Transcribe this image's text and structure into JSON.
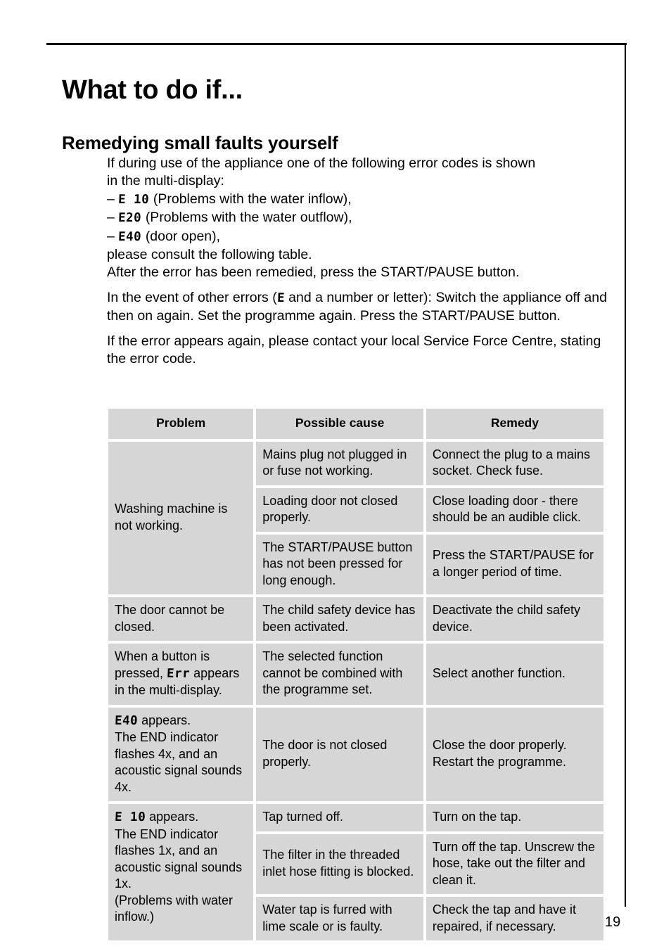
{
  "page": {
    "title": "What to do if...",
    "subtitle": "Remedying small faults yourself",
    "number": "19"
  },
  "intro": {
    "para1_line1": "If during use of the appliance one of the following error codes is shown",
    "para1_line2": "in the multi-display:",
    "bullet1_dash": "–",
    "bullet1_code": "E 10",
    "bullet1_text": "(Problems with the water inflow),",
    "bullet2_dash": "–",
    "bullet2_code": "E20",
    "bullet2_text": "(Problems with the water outflow),",
    "bullet3_dash": "–",
    "bullet3_code": "E40",
    "bullet3_text": "(door open),",
    "para1_line3": "please consult the following table.",
    "para1_line4": "After the error has been remedied, press the START/PAUSE button.",
    "para2_pre": "In the event of other errors (",
    "para2_code": "E",
    "para2_post": " and a number or letter): Switch the appliance off and then on again. Set the programme again. Press the START/PAUSE button.",
    "para3": "If the error appears again, please contact your local Service Force Centre, stating the error code."
  },
  "table": {
    "headers": {
      "problem": "Problem",
      "cause": "Possible cause",
      "remedy": "Remedy"
    },
    "rows": [
      {
        "problem": "Washing machine is not working.",
        "problem_rowspan": 3,
        "cause": "Mains plug not plugged in or fuse not working.",
        "remedy": "Connect the plug to a mains socket. Check fuse."
      },
      {
        "cause": "Loading door not closed properly.",
        "remedy": "Close loading door - there should be an audible click."
      },
      {
        "cause": "The START/PAUSE button has not been pressed for long enough.",
        "remedy": "Press the START/PAUSE for a longer period of time."
      },
      {
        "problem": "The door cannot be closed.",
        "problem_rowspan": 1,
        "cause": "The child safety device has been activated.",
        "remedy": "Deactivate the child safety device."
      },
      {
        "problem_pre": "When a button is pressed, ",
        "problem_code": "Err",
        "problem_post": " appears in the multi-display.",
        "problem_rowspan": 1,
        "cause": "The selected function cannot be combined with the programme set.",
        "remedy": "Select another function."
      },
      {
        "problem_code": "E40",
        "problem_post": " appears.\nThe END indicator flashes 4x, and an acoustic signal sounds 4x.",
        "problem_rowspan": 1,
        "cause": "The door is not closed properly.",
        "remedy": "Close the door properly. Restart the programme."
      },
      {
        "problem_code": "E 10",
        "problem_post": " appears.\nThe END indicator flashes 1x, and an acoustic signal sounds 1x.\n(Problems with water inflow.)",
        "problem_rowspan": 3,
        "cause": "Tap turned off.",
        "remedy": "Turn on the tap."
      },
      {
        "cause": "The filter in the threaded inlet hose fitting is blocked.",
        "remedy": "Turn off the tap. Unscrew the hose, take out the filter and clean it."
      },
      {
        "cause": "Water tap is furred with lime scale or is faulty.",
        "remedy": "Check the tap and have it repaired, if necessary."
      }
    ]
  },
  "colors": {
    "cell_background": "#d6d6d6",
    "page_background": "#ffffff",
    "text": "#000000"
  }
}
